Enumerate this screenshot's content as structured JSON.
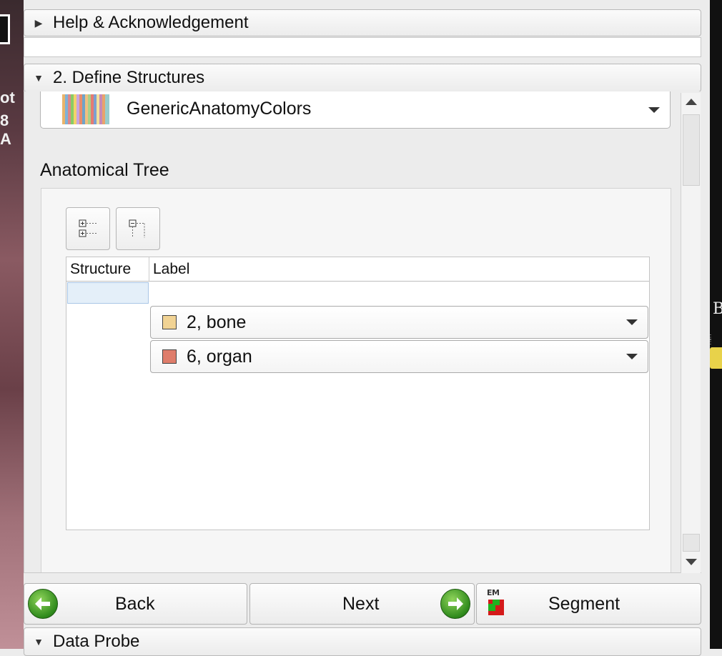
{
  "sections": {
    "help": {
      "title": "Help & Acknowledgement",
      "expanded": false
    },
    "define": {
      "title": "2. Define Structures",
      "expanded": true
    },
    "probe": {
      "title": "Data Probe",
      "expanded": true
    }
  },
  "color_table": {
    "selected": "GenericAnatomyColors"
  },
  "anatomical_tree": {
    "title": "Anatomical Tree",
    "columns": [
      "Structure",
      "Label"
    ],
    "labels": [
      {
        "text": "2, bone",
        "color": "#f1d394"
      },
      {
        "text": "6, organ",
        "color": "#df7d6b"
      }
    ]
  },
  "nav": {
    "back_label": "Back",
    "next_label": "Next",
    "segment_label": "Segment",
    "segment_icon_text": "EM"
  },
  "background": {
    "left_fragment_1": "ot",
    "left_fragment_2": "8 A",
    "right_fragment": "B"
  }
}
